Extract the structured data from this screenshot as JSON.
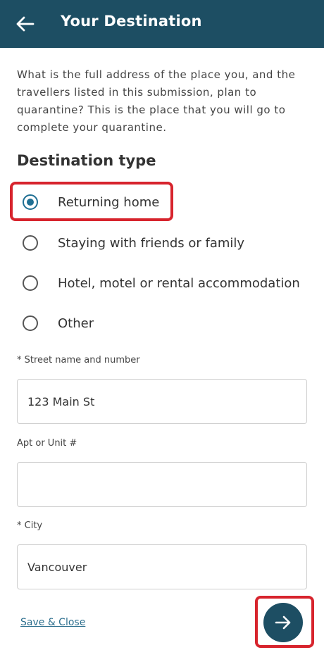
{
  "header": {
    "title": "Your Destination",
    "back_icon": "arrow-left-icon"
  },
  "intro_text": "What is the full address of the place you, and the travellers listed in this submission, plan to quarantine? This is the place that you will go to complete your quarantine.",
  "destination": {
    "title": "Destination type",
    "options": [
      {
        "label": "Returning home",
        "selected": true
      },
      {
        "label": "Staying with friends or family",
        "selected": false
      },
      {
        "label": "Hotel, motel or rental accommodation",
        "selected": false
      },
      {
        "label": "Other",
        "selected": false
      }
    ]
  },
  "fields": {
    "street": {
      "label": "* Street name and number",
      "value": "123 Main St"
    },
    "apt": {
      "label": "Apt or Unit #",
      "value": ""
    },
    "city": {
      "label": "* City",
      "value": "Vancouver"
    }
  },
  "footer": {
    "save_label": "Save & Close",
    "next_icon": "arrow-right-icon"
  },
  "colors": {
    "header_bg": "#1d4e63",
    "accent": "#1f6f93",
    "highlight": "#d7242d"
  }
}
